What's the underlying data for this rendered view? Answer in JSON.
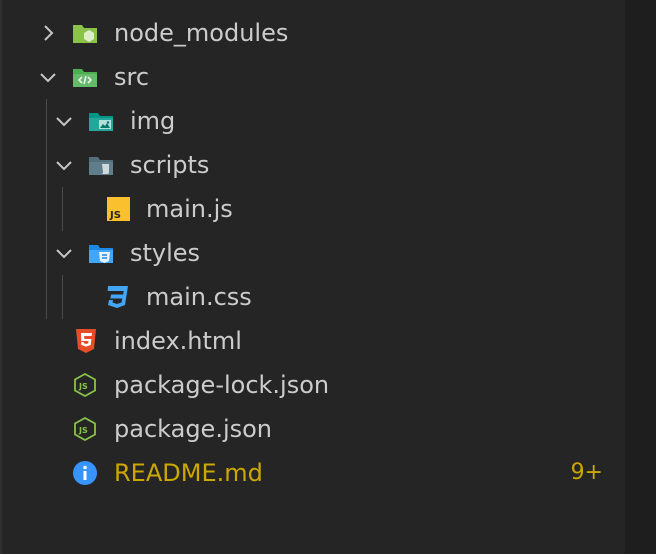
{
  "explorer": {
    "items": [
      {
        "id": "node_modules",
        "label": "node_modules",
        "type": "folder",
        "expanded": false,
        "icon": "node-modules-folder-icon"
      },
      {
        "id": "src",
        "label": "src",
        "type": "folder",
        "expanded": true,
        "icon": "src-folder-icon"
      },
      {
        "id": "img",
        "label": "img",
        "type": "folder",
        "expanded": true,
        "icon": "img-folder-icon"
      },
      {
        "id": "scripts",
        "label": "scripts",
        "type": "folder",
        "expanded": true,
        "icon": "scripts-folder-icon"
      },
      {
        "id": "main_js",
        "label": "main.js",
        "type": "file",
        "icon": "javascript-file-icon"
      },
      {
        "id": "styles",
        "label": "styles",
        "type": "folder",
        "expanded": true,
        "icon": "styles-folder-icon"
      },
      {
        "id": "main_css",
        "label": "main.css",
        "type": "file",
        "icon": "css-file-icon"
      },
      {
        "id": "index_html",
        "label": "index.html",
        "type": "file",
        "icon": "html-file-icon"
      },
      {
        "id": "package_lock",
        "label": "package-lock.json",
        "type": "file",
        "icon": "nodejs-file-icon"
      },
      {
        "id": "package_json",
        "label": "package.json",
        "type": "file",
        "icon": "nodejs-file-icon"
      },
      {
        "id": "readme",
        "label": "README.md",
        "type": "file",
        "icon": "info-icon",
        "badge": "9+"
      }
    ]
  },
  "colors": {
    "background": "#252526",
    "text": "#cccccc",
    "warning": "#cca700",
    "node_green": "#8bc34a",
    "src_green": "#4caf50",
    "teal": "#26a69a",
    "gray_folder": "#607d8b",
    "blue_folder": "#42a5f5",
    "js_yellow": "#fbc02d",
    "css_blue": "#42a5f5",
    "html_orange": "#e44d26",
    "info_blue": "#3794ff"
  }
}
